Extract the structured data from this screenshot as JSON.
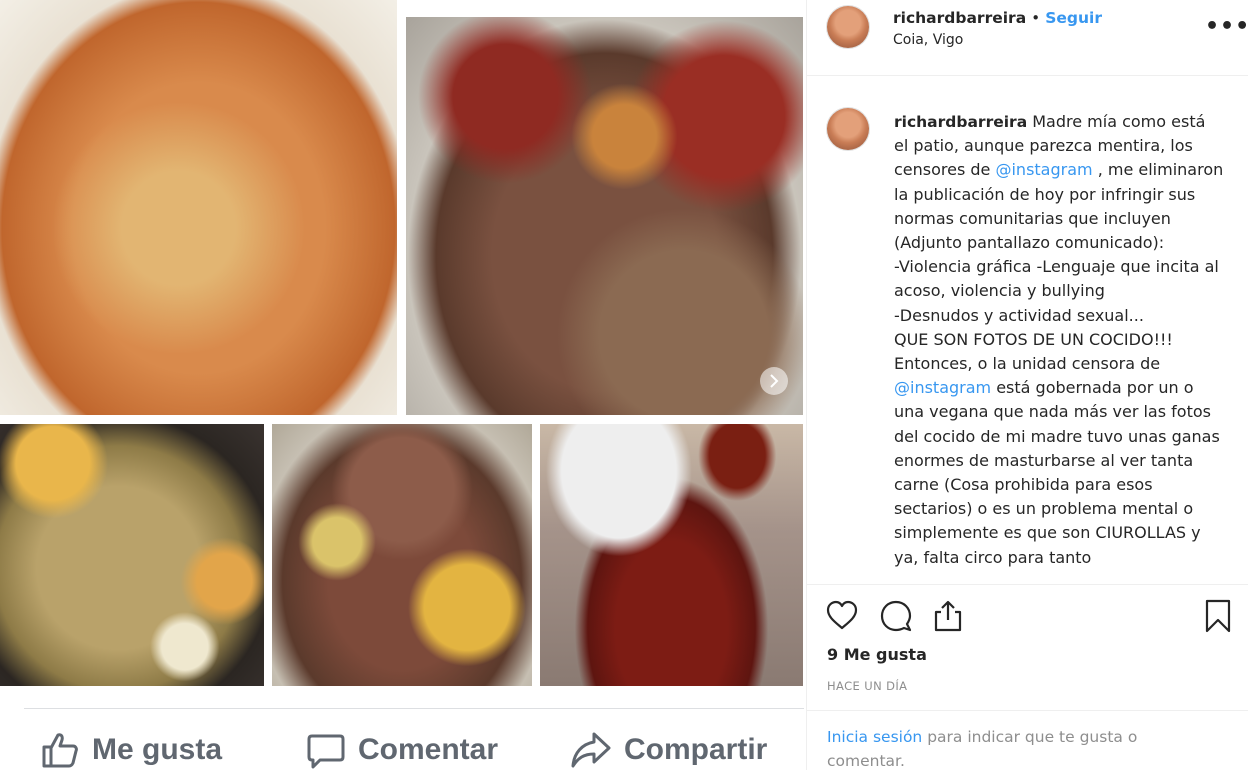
{
  "post": {
    "username": "richardbarreira",
    "separator": "•",
    "follow_label": "Seguir",
    "location": "Coia, Vigo",
    "more_label": "•••",
    "caption_username": "richardbarreira",
    "caption_parts": [
      " Madre mía como está el patio, aunque parezca mentira, los censores de ",
      "@instagram",
      " , me eliminaron la publicación de hoy por infringir sus normas comunitarias que incluyen (Adjunto pantallazo comunicado):\n-Violencia gráfica -Lenguaje que incita al acoso, violencia y bullying\n-Desnudos y actividad sexual...\nQUE SON FOTOS DE UN COCIDO!!!\nEntonces, o la unidad censora de ",
      "@instagram",
      " está gobernada por un o una vegana que nada más ver las fotos del cocido de mi madre tuvo unas ganas enormes de masturbarse al ver tanta carne (Cosa prohibida para esos sectarios) o es un problema mental o simplemente es que son CIUROLLAS y ya, falta circo para tanto"
    ],
    "likes": "9 Me gusta",
    "date": "HACE UN DÍA",
    "login_link": "Inicia sesión",
    "login_rest": " para indicar que te gusta o comentar."
  },
  "facebook": {
    "like_label": "Me gusta",
    "comment_label": "Comentar",
    "share_label": "Compartir"
  },
  "photos": [
    "chickpeas-soup",
    "boiled-meats-platter",
    "cabbage-chickpeas-pot",
    "meat-and-chicken",
    "chorizo-plate"
  ],
  "colors": {
    "link_blue": "#3897f0",
    "fb_grey": "#606770",
    "text": "#262626",
    "muted": "#8e8e8e"
  }
}
